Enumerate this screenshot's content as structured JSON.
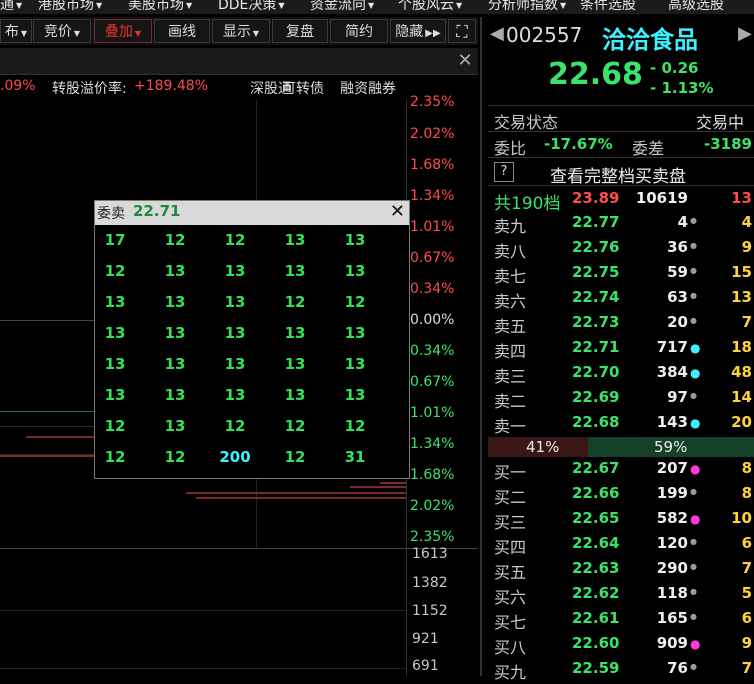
{
  "top_menu": [
    {
      "label": "通"
    },
    {
      "label": "港股市场"
    },
    {
      "label": "美股市场"
    },
    {
      "label": "DDE决策"
    },
    {
      "label": "资金流向"
    },
    {
      "label": "个股风云"
    },
    {
      "label": "分析师指数"
    },
    {
      "label": "条件选股"
    },
    {
      "label": "高级选股"
    }
  ],
  "toolbar": {
    "items": [
      {
        "label": "布"
      },
      {
        "label": "竞价"
      },
      {
        "label": "叠加"
      },
      {
        "label": "画线"
      },
      {
        "label": "显示"
      },
      {
        "label": "复盘"
      },
      {
        "label": "简约"
      },
      {
        "label": "隐藏"
      }
    ]
  },
  "stats": {
    "prefix": ".09%",
    "premium_label": "转股溢价率:",
    "premium_value": "+189.48%",
    "link1": "深股通",
    "link2": "可转债",
    "link3": "融资融券"
  },
  "axis_pct": [
    "2.35%",
    "2.02%",
    "1.68%",
    "1.34%",
    "1.01%",
    "0.67%",
    "0.34%",
    "0.00%",
    "0.34%",
    "0.67%",
    "1.01%",
    "1.34%",
    "1.68%",
    "2.02%",
    "2.35%"
  ],
  "axis_vol": [
    "1613",
    "1382",
    "1152",
    "921",
    "691"
  ],
  "popup": {
    "title": "委卖",
    "price": "22.71",
    "rows": [
      [
        "17",
        "12",
        "12",
        "13",
        "13"
      ],
      [
        "12",
        "13",
        "13",
        "13",
        "13"
      ],
      [
        "13",
        "13",
        "13",
        "12",
        "12"
      ],
      [
        "13",
        "13",
        "13",
        "13",
        "13"
      ],
      [
        "13",
        "13",
        "13",
        "13",
        "13"
      ],
      [
        "13",
        "13",
        "13",
        "13",
        "13"
      ],
      [
        "12",
        "13",
        "12",
        "12",
        "12"
      ],
      [
        "12",
        "12",
        "200",
        "12",
        "31"
      ]
    ]
  },
  "quote": {
    "code": "002557",
    "name": "洽洽食品",
    "price": "22.68",
    "change": "- 0.26",
    "change_pct": "- 1.13%",
    "status_label": "交易状态",
    "status_value": "交易中",
    "webi_label": "委比",
    "webi_value": "-17.67%",
    "weicha_label": "委差",
    "weicha_value": "-3189",
    "help": "?",
    "full_book": "查看完整档买卖盘",
    "total_label": "共190档",
    "total_price": "23.89",
    "total_vol": "10619",
    "total_chg": "13",
    "sell_pct": "41%",
    "buy_pct": "59%"
  },
  "sells": [
    {
      "label": "卖九",
      "price": "22.77",
      "vol": "4",
      "dot": "gray",
      "chg": "4"
    },
    {
      "label": "卖八",
      "price": "22.76",
      "vol": "36",
      "dot": "gray",
      "chg": "9"
    },
    {
      "label": "卖七",
      "price": "22.75",
      "vol": "59",
      "dot": "gray",
      "chg": "15"
    },
    {
      "label": "卖六",
      "price": "22.74",
      "vol": "63",
      "dot": "gray",
      "chg": "13"
    },
    {
      "label": "卖五",
      "price": "22.73",
      "vol": "20",
      "dot": "gray",
      "chg": "7"
    },
    {
      "label": "卖四",
      "price": "22.71",
      "vol": "717",
      "dot": "cyan",
      "chg": "18"
    },
    {
      "label": "卖三",
      "price": "22.70",
      "vol": "384",
      "dot": "cyan",
      "chg": "48"
    },
    {
      "label": "卖二",
      "price": "22.69",
      "vol": "97",
      "dot": "gray",
      "chg": "14"
    },
    {
      "label": "卖一",
      "price": "22.68",
      "vol": "143",
      "dot": "cyan",
      "chg": "20"
    }
  ],
  "buys": [
    {
      "label": "买一",
      "price": "22.67",
      "vol": "207",
      "dot": "magenta",
      "chg": "8"
    },
    {
      "label": "买二",
      "price": "22.66",
      "vol": "199",
      "dot": "gray",
      "chg": "8"
    },
    {
      "label": "买三",
      "price": "22.65",
      "vol": "582",
      "dot": "magenta",
      "chg": "10"
    },
    {
      "label": "买四",
      "price": "22.64",
      "vol": "120",
      "dot": "gray",
      "chg": "6"
    },
    {
      "label": "买五",
      "price": "22.63",
      "vol": "290",
      "dot": "gray",
      "chg": "7"
    },
    {
      "label": "买六",
      "price": "22.62",
      "vol": "118",
      "dot": "gray",
      "chg": "5"
    },
    {
      "label": "买七",
      "price": "22.61",
      "vol": "165",
      "dot": "gray",
      "chg": "6"
    },
    {
      "label": "买八",
      "price": "22.60",
      "vol": "909",
      "dot": "magenta",
      "chg": "9"
    },
    {
      "label": "买九",
      "price": "22.59",
      "vol": "76",
      "dot": "gray",
      "chg": "7"
    }
  ],
  "colors": {
    "up": "#ff4b4b",
    "down": "#3be36a",
    "cyan": "#3cf0ff",
    "magenta": "#ff3ad6",
    "gray": "#9a9a9a"
  }
}
